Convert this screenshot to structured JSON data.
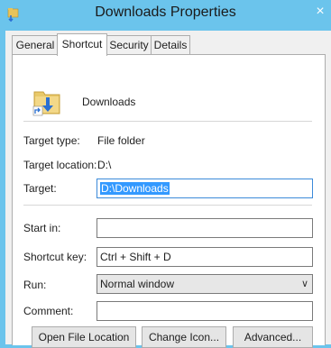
{
  "window": {
    "title": "Downloads Properties",
    "close_symbol": "×",
    "icon": "folder-shortcut-icon"
  },
  "tabs": [
    {
      "label": "General",
      "active": false
    },
    {
      "label": "Shortcut",
      "active": true
    },
    {
      "label": "Security",
      "active": false
    },
    {
      "label": "Details",
      "active": false
    }
  ],
  "shortcut": {
    "name": "Downloads",
    "icon": "downloads-folder-icon",
    "target_type_label": "Target type:",
    "target_type_value": "File folder",
    "target_location_label": "Target location:",
    "target_location_value": "D:\\",
    "target_label": "Target:",
    "target_value": "D:\\Downloads",
    "start_in_label": "Start in:",
    "start_in_value": "",
    "shortcut_key_label": "Shortcut key:",
    "shortcut_key_value": "Ctrl + Shift + D",
    "run_label": "Run:",
    "run_value": "Normal window",
    "comment_label": "Comment:",
    "comment_value": ""
  },
  "buttons": {
    "open_file_location": "Open File Location",
    "change_icon": "Change Icon...",
    "advanced": "Advanced..."
  },
  "colors": {
    "titlebar": "#6bc4ec",
    "selection": "#3399ff"
  }
}
